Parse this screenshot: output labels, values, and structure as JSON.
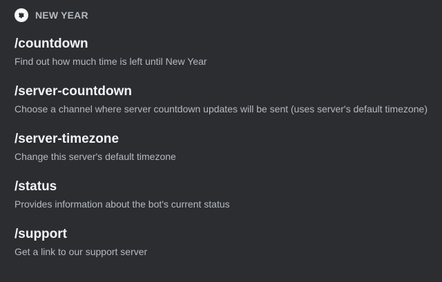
{
  "category": {
    "title": "NEW YEAR",
    "avatar_icon": "bot-avatar-icon"
  },
  "commands": [
    {
      "name": "/countdown",
      "description": "Find out how much time is left until New Year"
    },
    {
      "name": "/server-countdown",
      "description": "Choose a channel where server countdown updates will be sent (uses server's default timezone)"
    },
    {
      "name": "/server-timezone",
      "description": "Change this server's default timezone"
    },
    {
      "name": "/status",
      "description": "Provides information about the bot's current status"
    },
    {
      "name": "/support",
      "description": "Get a link to our support server"
    }
  ],
  "colors": {
    "background": "#2b2d31",
    "heading": "#f2f3f5",
    "muted": "#b5bac1"
  }
}
